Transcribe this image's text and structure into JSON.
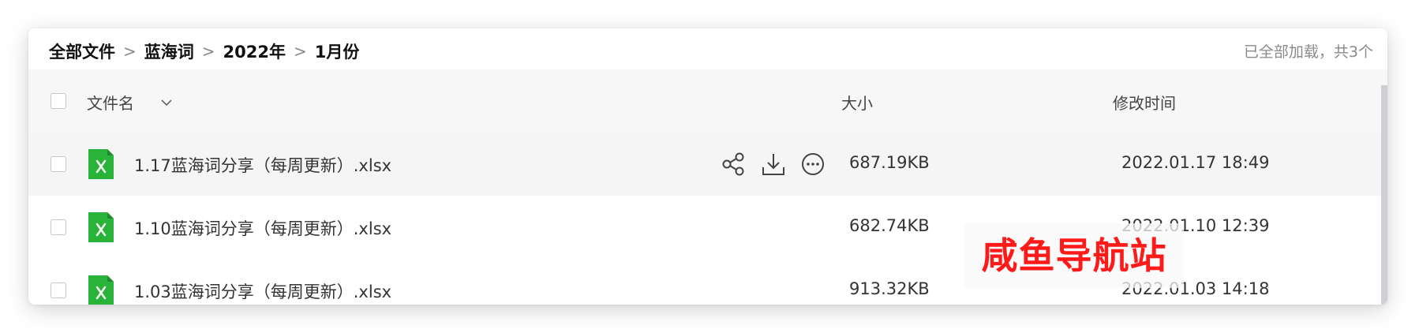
{
  "breadcrumb": {
    "items": [
      "全部文件",
      "蓝海词",
      "2022年",
      "1月份"
    ],
    "separator": ">"
  },
  "status": {
    "loaded_text": "已全部加载，共3个"
  },
  "table": {
    "headers": {
      "name": "文件名",
      "size": "大小",
      "modified": "修改时间"
    },
    "rows": [
      {
        "icon": "excel-file-icon",
        "name": "1.17蓝海词分享（每周更新）.xlsx",
        "size": "687.19KB",
        "modified": "2022.01.17 18:49",
        "hovered": true
      },
      {
        "icon": "excel-file-icon",
        "name": "1.10蓝海词分享（每周更新）.xlsx",
        "size": "682.74KB",
        "modified": "2022.01.10 12:39",
        "hovered": false
      },
      {
        "icon": "excel-file-icon",
        "name": "1.03蓝海词分享（每周更新）.xlsx",
        "size": "913.32KB",
        "modified": "2022.01.03 14:18",
        "hovered": false
      }
    ],
    "row_actions": [
      "share-icon",
      "download-icon",
      "more-icon"
    ]
  },
  "watermark": {
    "text": "咸鱼导航站"
  },
  "colors": {
    "excel_green": "#29b33a",
    "watermark_red": "#ff1a1a",
    "hover_row": "#f5f5f6"
  }
}
